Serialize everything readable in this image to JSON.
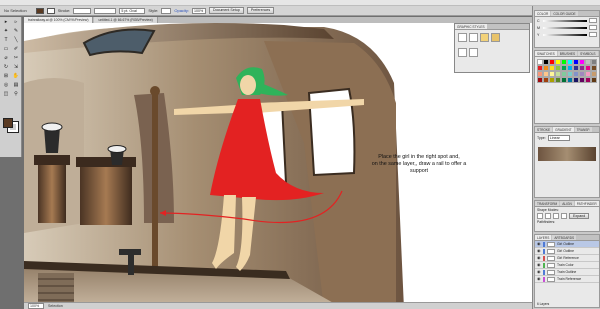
{
  "control_bar": {
    "selection_label": "No Selection",
    "stroke_label": "Stroke:",
    "brush_value": "5 pt. Oval",
    "style_label": "Style:",
    "opacity_label": "Opacity:",
    "opacity_value": "100",
    "opacity_unit": "%",
    "document_setup": "Document Setup",
    "preferences": "Preferences"
  },
  "document_tabs": [
    {
      "label": "trainrailway.ai @ 100% (CMYK/Preview)"
    },
    {
      "label": "untitled-1 @ 66.67% (RGB/Preview)"
    }
  ],
  "tools": [
    "▸",
    "▹",
    "✦",
    "✎",
    "T",
    "╲",
    "▭",
    "✐",
    "⌀",
    "✂",
    "↻",
    "⇲",
    "⊞",
    "✋",
    "◎",
    "▤",
    "◫",
    "⚲"
  ],
  "canvas": {
    "instruction_line1": "Place the girl in the right spot and,",
    "instruction_line2": "on the same layer,, draw a rail to offer a support",
    "fill_color": "#5a3a22"
  },
  "graphic_styles": {
    "tab_label": "GRAPHIC STYLES"
  },
  "panels": {
    "color_tabs": [
      "COLOR",
      "COLOR GUIDE"
    ],
    "sliders": [
      "C",
      "M",
      "Y",
      "K"
    ],
    "swatch_tabs": [
      "SWATCHES",
      "BRUSHES",
      "SYMBOLS"
    ],
    "swatch_colors": [
      "#ffffff",
      "#000000",
      "#ff0000",
      "#ffff00",
      "#00ff00",
      "#00ffff",
      "#0000ff",
      "#ff00ff",
      "#c0c0c0",
      "#808080",
      "#e31e24",
      "#f28e1c",
      "#fde11e",
      "#8dc63f",
      "#00a651",
      "#00aeef",
      "#2e3192",
      "#92278f",
      "#ec008c",
      "#754c24",
      "#f7977a",
      "#fdc68a",
      "#fff79a",
      "#c4df9b",
      "#82ca9c",
      "#7accc8",
      "#8493ca",
      "#a187be",
      "#f49ac2",
      "#c69c6d",
      "#9e0b0f",
      "#a0410d",
      "#aba000",
      "#598527",
      "#007236",
      "#0076a3",
      "#1b1464",
      "#630460",
      "#9e005d",
      "#603913"
    ],
    "gradient_tabs": [
      "STROKE",
      "GRADIENT",
      "TRANSP."
    ],
    "gradient_type_label": "Type:",
    "gradient_type_value": "Linear",
    "pathfinder_tabs": [
      "TRANSFORM",
      "ALIGN",
      "PATHFINDER"
    ],
    "shape_modes_label": "Shape Modes:",
    "pathfinders_label": "Pathfinders:",
    "expand_label": "Expand",
    "layers_tabs": [
      "LAYERS",
      "ARTBOARDS"
    ],
    "layers": [
      {
        "name": "Girl Outline",
        "color": "#4f7bd6",
        "selected": true
      },
      {
        "name": "Girl Outline",
        "color": "#4f7bd6",
        "selected": false
      },
      {
        "name": "Girl Reference",
        "color": "#d64f4f",
        "selected": false
      },
      {
        "name": "Train Color",
        "color": "#4fb34f",
        "selected": false
      },
      {
        "name": "Train Outline",
        "color": "#4f7bd6",
        "selected": false
      },
      {
        "name": "Train Reference",
        "color": "#c84fd6",
        "selected": false
      }
    ],
    "layers_count": "6 Layers"
  },
  "status_bar": {
    "zoom": "100%",
    "tool_name": "Selection"
  }
}
